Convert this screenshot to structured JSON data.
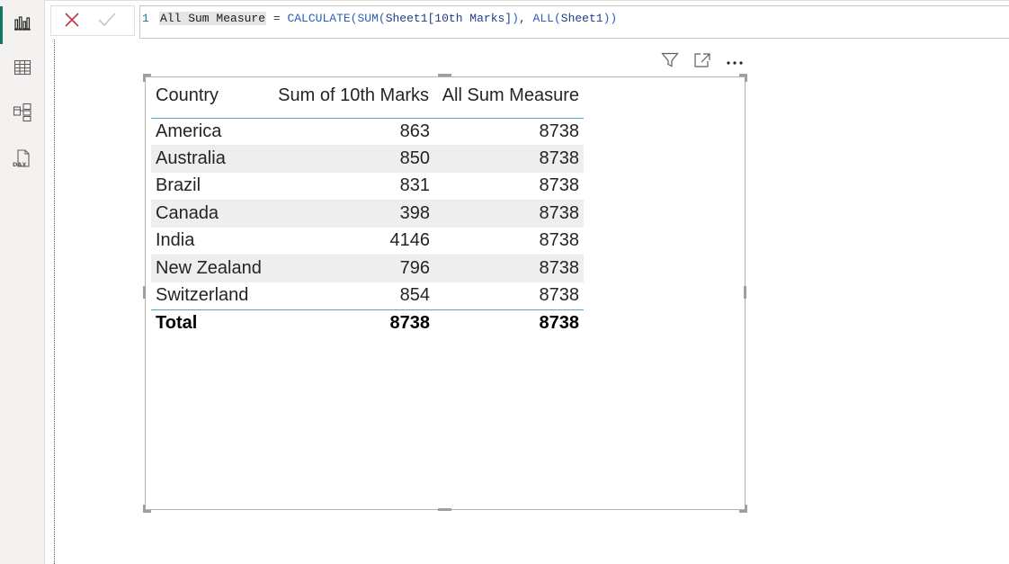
{
  "formula_bar": {
    "line_number": "1",
    "measure_name": "All Sum Measure",
    "equals": " = ",
    "func_calculate": "CALCULATE",
    "func_sum": "SUM",
    "ref_column": "Sheet1[10th Marks]",
    "func_all": "ALL",
    "ref_table": "Sheet1",
    "cancel_icon": "close-icon",
    "commit_icon": "check-icon"
  },
  "rail": {
    "items": [
      {
        "icon": "report-view-icon",
        "active": true
      },
      {
        "icon": "table-view-icon",
        "active": false
      },
      {
        "icon": "model-view-icon",
        "active": false
      },
      {
        "icon": "dax-query-view-icon",
        "active": false
      }
    ]
  },
  "visual_header": {
    "icons": [
      "filter-icon",
      "focus-mode-icon",
      "more-options-icon"
    ]
  },
  "table": {
    "columns": [
      "Country",
      "Sum of 10th Marks",
      "All Sum Measure"
    ],
    "rows": [
      {
        "country": "America",
        "sum": "863",
        "all": "8738"
      },
      {
        "country": "Australia",
        "sum": "850",
        "all": "8738"
      },
      {
        "country": "Brazil",
        "sum": "831",
        "all": "8738"
      },
      {
        "country": "Canada",
        "sum": "398",
        "all": "8738"
      },
      {
        "country": "India",
        "sum": "4146",
        "all": "8738"
      },
      {
        "country": "New Zealand",
        "sum": "796",
        "all": "8738"
      },
      {
        "country": "Switzerland",
        "sum": "854",
        "all": "8738"
      }
    ],
    "total": {
      "label": "Total",
      "sum": "8738",
      "all": "8738"
    }
  },
  "colors": {
    "accent": "#117865",
    "header_rule": "#5aa2c8",
    "alt_row": "#eeeeee"
  }
}
